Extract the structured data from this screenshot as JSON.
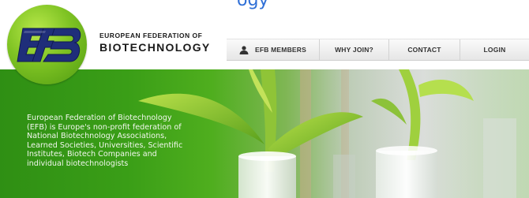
{
  "topline": {
    "partial_text": "ogy"
  },
  "brand": {
    "line1": "EUROPEAN FEDERATION OF",
    "line2": "BIOTECHNOLOGY",
    "logo_text": "EFB",
    "logo_color": "#7fc323",
    "logo_mark_color": "#1f2e7a"
  },
  "nav": {
    "items": [
      {
        "label": "EFB MEMBERS",
        "icon": "user-icon"
      },
      {
        "label": "WHY JOIN?"
      },
      {
        "label": "CONTACT"
      },
      {
        "label": "LOGIN"
      }
    ]
  },
  "hero": {
    "text": "European Federation of Biotechnology (EFB) is Europe's non-profit federation of National Biotechnology Associations, Learned Societies, Universities, Scientific Institutes, Biotech Companies and individual biotechnologists",
    "colors": {
      "green": "#3a9e17",
      "light": "#d2d6d2"
    }
  }
}
